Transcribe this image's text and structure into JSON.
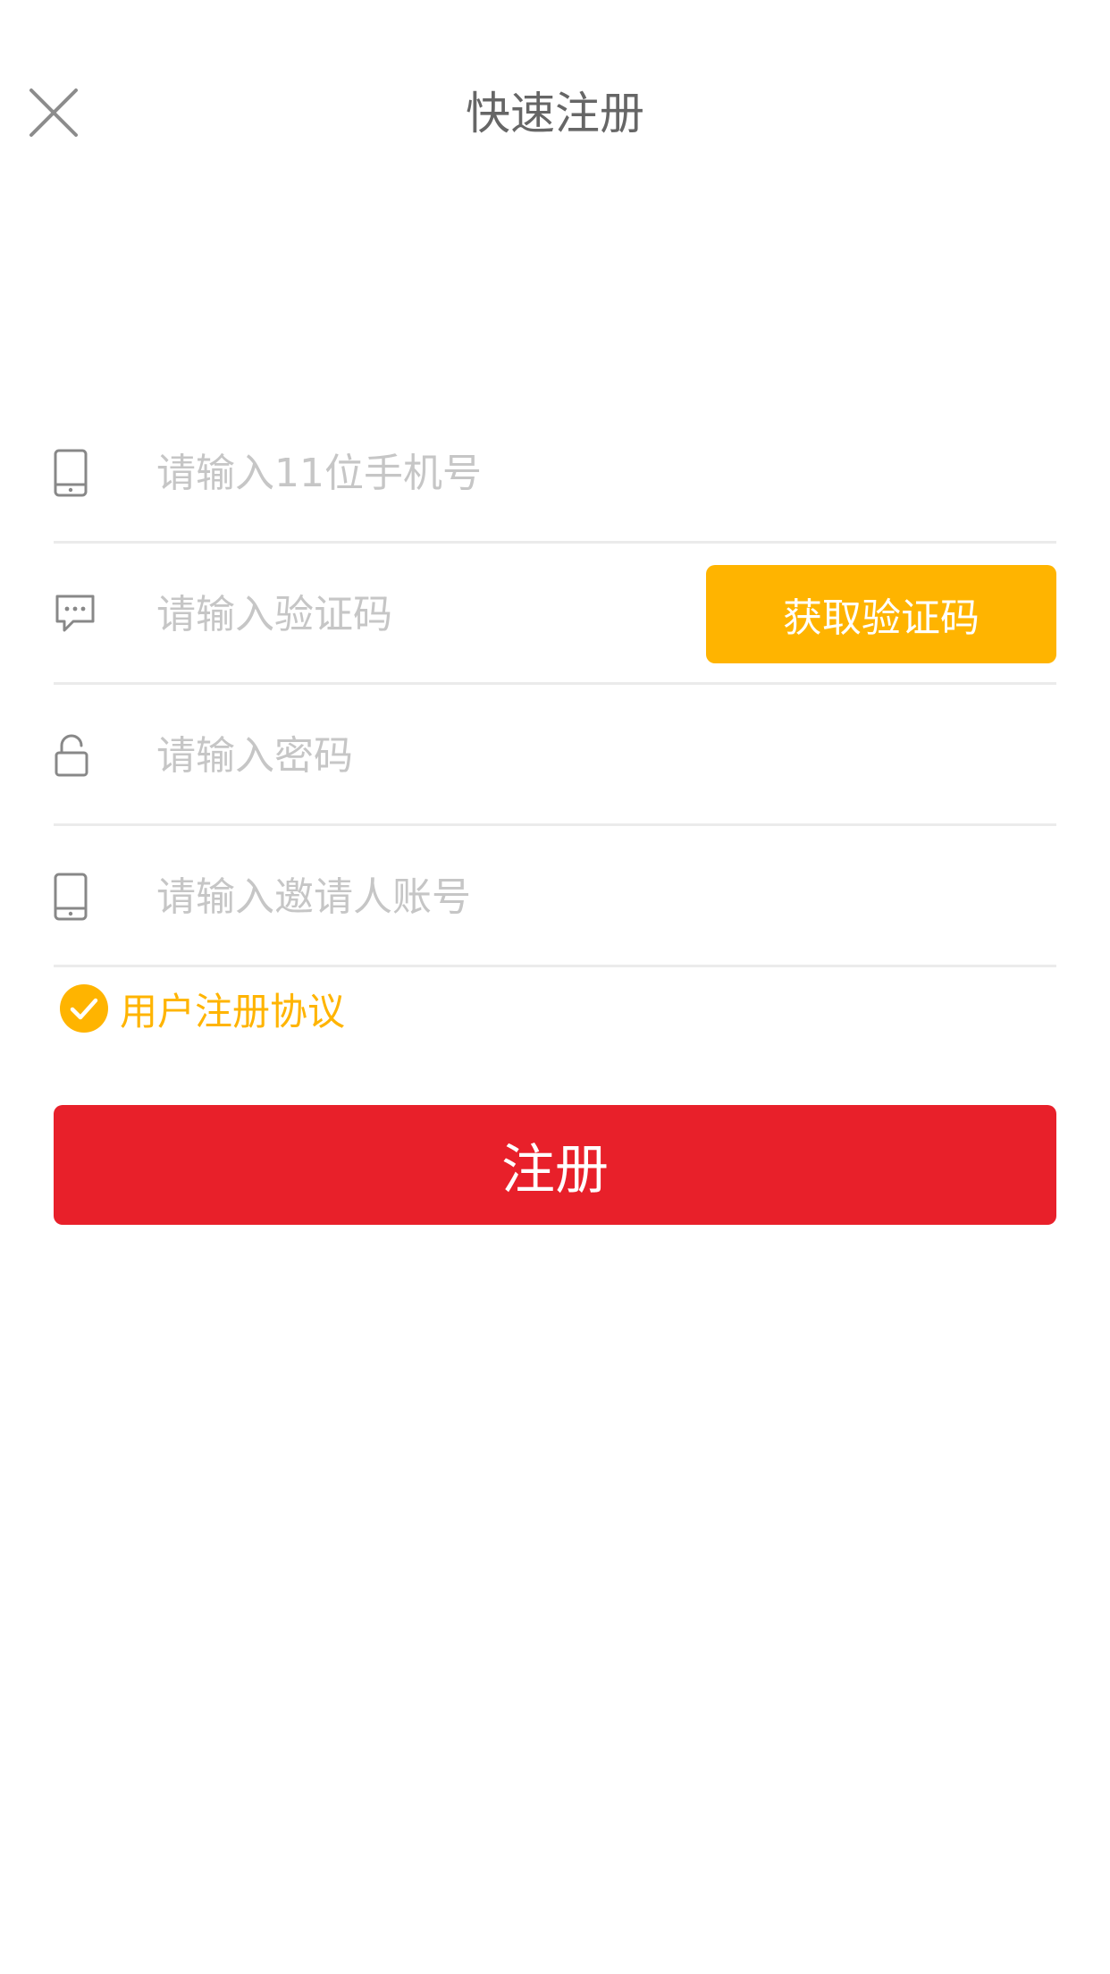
{
  "header": {
    "title": "快速注册",
    "close_icon": "close-icon"
  },
  "form": {
    "phone": {
      "placeholder": "请输入11位手机号",
      "value": "",
      "icon": "phone-icon"
    },
    "code": {
      "placeholder": "请输入验证码",
      "value": "",
      "icon": "message-icon",
      "button_label": "获取验证码"
    },
    "password": {
      "placeholder": "请输入密码",
      "value": "",
      "icon": "lock-icon"
    },
    "inviter": {
      "placeholder": "请输入邀请人账号",
      "value": "",
      "icon": "phone-icon"
    }
  },
  "agreement": {
    "checked": true,
    "label": "用户注册协议"
  },
  "register": {
    "label": "注册"
  },
  "colors": {
    "accent": "#ffb400",
    "primary": "#e8202a",
    "placeholder": "#c6c6c6",
    "title": "#666666",
    "divider": "#ebebeb"
  }
}
